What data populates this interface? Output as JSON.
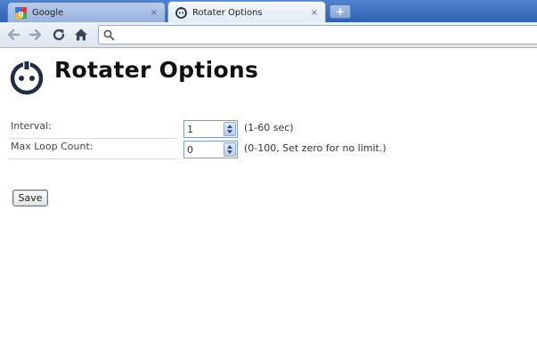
{
  "browser": {
    "tabs": [
      {
        "label": "Google",
        "icon": "google-icon",
        "active": false
      },
      {
        "label": "Rotater Options",
        "icon": "rotater-icon",
        "active": true
      }
    ],
    "tab_close_glyph": "×",
    "new_tab_glyph": "+",
    "url": ""
  },
  "page": {
    "title": "Rotater Options",
    "options": [
      {
        "label": "Interval:",
        "value": "1",
        "hint": "(1-60 sec)"
      },
      {
        "label": "Max Loop Count:",
        "value": "0",
        "hint": "(0-100, Set zero for no limit.)"
      }
    ],
    "save_label": "Save"
  },
  "colors": {
    "tabstrip": "#3c6fc0",
    "logo": "#1f2d45"
  }
}
